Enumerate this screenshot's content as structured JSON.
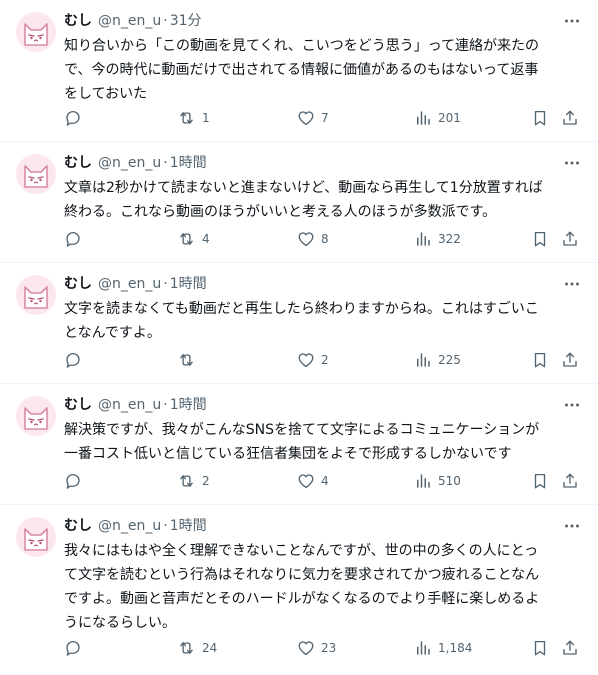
{
  "colors": {
    "text": "#0f1419",
    "secondary": "#536471",
    "divider": "#eff3f4",
    "avatar_bg": "#fde7ee",
    "avatar_stroke": "#d98ca4"
  },
  "icons": {
    "reply": "reply-icon",
    "retweet": "retweet-icon",
    "like": "heart-icon",
    "views": "views-chart-icon",
    "bookmark": "bookmark-icon",
    "share": "share-icon",
    "more": "more-dots-icon",
    "avatar": "cat-avatar-icon"
  },
  "tweets": [
    {
      "name": "むし",
      "handle": "@n_en_u",
      "separator": "·",
      "time": "31分",
      "text": "知り合いから「この動画を見てくれ、こいつをどう思う」って連絡が来たの\nで、今の時代に動画だけで出されてる情報に価値があるのもはないって返事\nをしておいた",
      "replies": "",
      "retweets": "1",
      "likes": "7",
      "views": "201"
    },
    {
      "name": "むし",
      "handle": "@n_en_u",
      "separator": "·",
      "time": "1時間",
      "text": "文章は2秒かけて読まないと進まないけど、動画なら再生して1分放置すれば\n終わる。これなら動画のほうがいいと考える人のほうが多数派です。",
      "replies": "",
      "retweets": "4",
      "likes": "8",
      "views": "322"
    },
    {
      "name": "むし",
      "handle": "@n_en_u",
      "separator": "·",
      "time": "1時間",
      "text": "文字を読まなくても動画だと再生したら終わりますからね。これはすごいこ\nとなんですよ。",
      "replies": "",
      "retweets": "",
      "likes": "2",
      "views": "225"
    },
    {
      "name": "むし",
      "handle": "@n_en_u",
      "separator": "·",
      "time": "1時間",
      "text": "解決策ですが、我々がこんなSNSを捨てて文字によるコミュニケーションが\n一番コスト低いと信じている狂信者集団をよそで形成するしかないです",
      "replies": "",
      "retweets": "2",
      "likes": "4",
      "views": "510"
    },
    {
      "name": "むし",
      "handle": "@n_en_u",
      "separator": "·",
      "time": "1時間",
      "text": "我々にはもはや全く理解できないことなんですが、世の中の多くの人にとっ\nて文字を読むという行為はそれなりに気力を要求されてかつ疲れることなん\nですよ。動画と音声だとそのハードルがなくなるのでより手軽に楽しめるよ\nうになるらしい。",
      "replies": "",
      "retweets": "24",
      "likes": "23",
      "views": "1,184"
    }
  ]
}
